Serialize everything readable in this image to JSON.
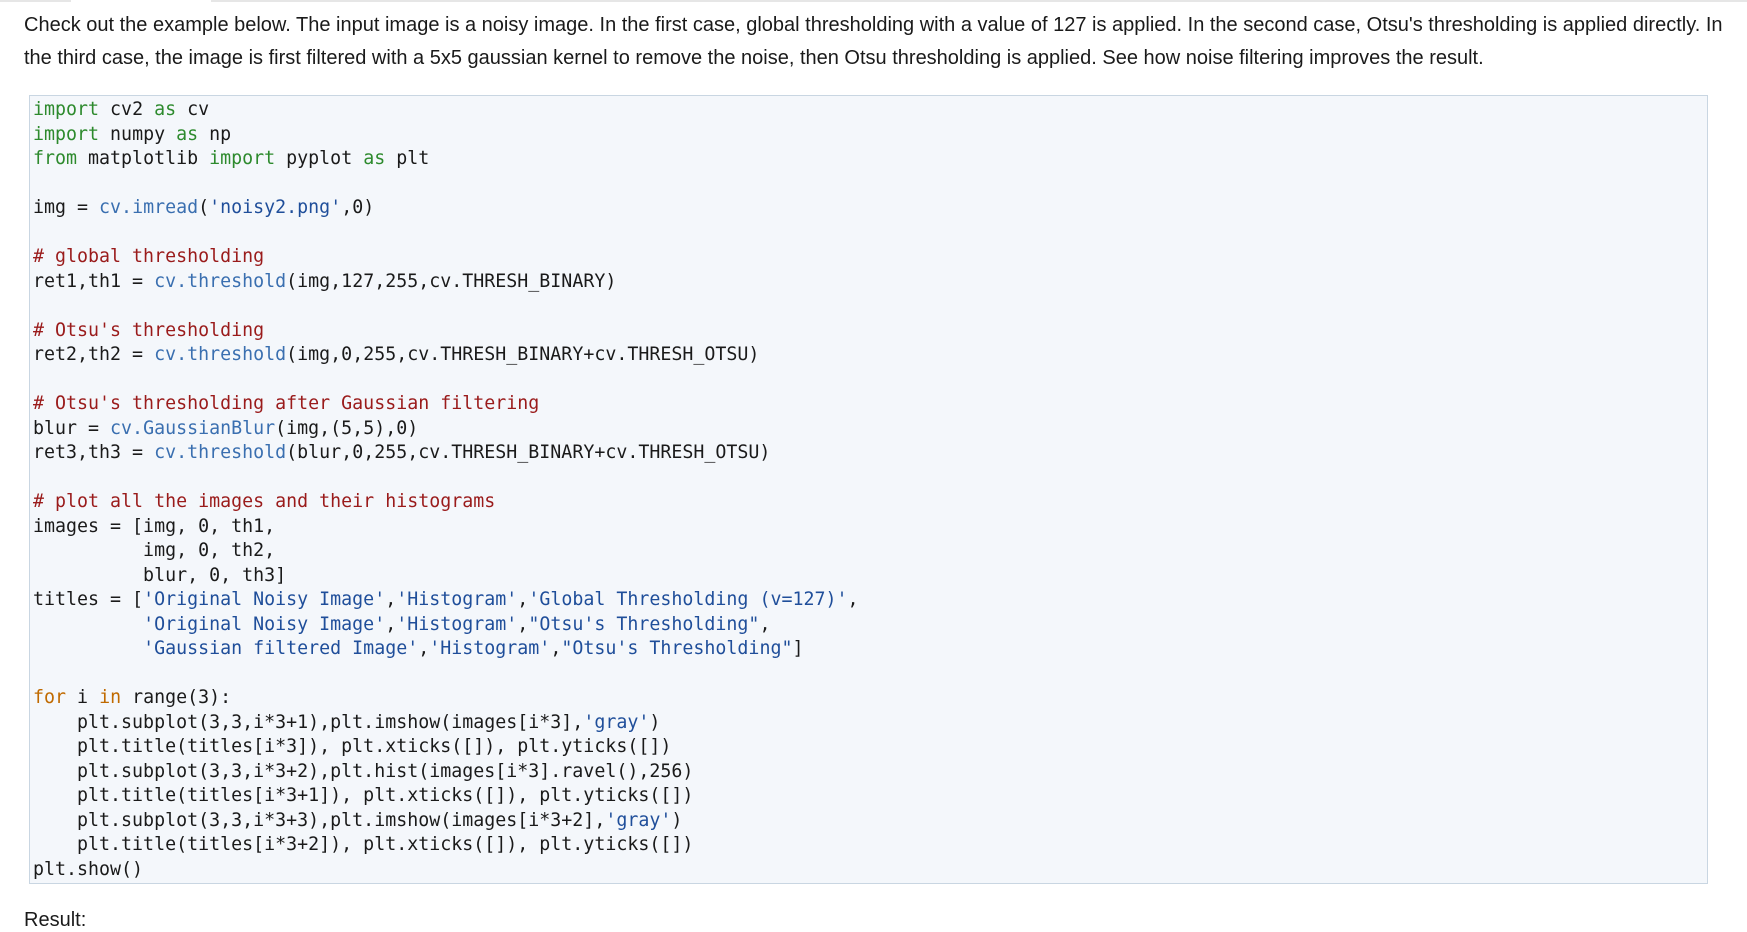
{
  "intro": {
    "text": "Check out the example below. The input image is a noisy image. In the first case, global thresholding with a value of 127 is applied. In the second case, Otsu's thresholding is applied directly. In the third case, the image is first filtered with a 5x5 gaussian kernel to remove the noise, then Otsu thresholding is applied. See how noise filtering improves the result."
  },
  "code": {
    "lines": [
      [
        {
          "t": "import",
          "c": "kw"
        },
        {
          "t": " cv2 "
        },
        {
          "t": "as",
          "c": "kw"
        },
        {
          "t": " cv"
        }
      ],
      [
        {
          "t": "import",
          "c": "kw"
        },
        {
          "t": " numpy "
        },
        {
          "t": "as",
          "c": "kw"
        },
        {
          "t": " np"
        }
      ],
      [
        {
          "t": "from",
          "c": "kw"
        },
        {
          "t": " matplotlib "
        },
        {
          "t": "import",
          "c": "kw"
        },
        {
          "t": " pyplot "
        },
        {
          "t": "as",
          "c": "kw"
        },
        {
          "t": " plt"
        }
      ],
      [],
      [
        {
          "t": "img = "
        },
        {
          "t": "cv.imread",
          "c": "fn"
        },
        {
          "t": "("
        },
        {
          "t": "'noisy2.png'",
          "c": "st"
        },
        {
          "t": ",0)"
        }
      ],
      [],
      [
        {
          "t": "# global thresholding",
          "c": "cm"
        }
      ],
      [
        {
          "t": "ret1,th1 = "
        },
        {
          "t": "cv.threshold",
          "c": "fn"
        },
        {
          "t": "(img,127,255,cv.THRESH_BINARY)"
        }
      ],
      [],
      [
        {
          "t": "# Otsu's thresholding",
          "c": "cm"
        }
      ],
      [
        {
          "t": "ret2,th2 = "
        },
        {
          "t": "cv.threshold",
          "c": "fn"
        },
        {
          "t": "(img,0,255,cv.THRESH_BINARY+cv.THRESH_OTSU)"
        }
      ],
      [],
      [
        {
          "t": "# Otsu's thresholding after Gaussian filtering",
          "c": "cm"
        }
      ],
      [
        {
          "t": "blur = "
        },
        {
          "t": "cv.GaussianBlur",
          "c": "fn"
        },
        {
          "t": "(img,(5,5),0)"
        }
      ],
      [
        {
          "t": "ret3,th3 = "
        },
        {
          "t": "cv.threshold",
          "c": "fn"
        },
        {
          "t": "(blur,0,255,cv.THRESH_BINARY+cv.THRESH_OTSU)"
        }
      ],
      [],
      [
        {
          "t": "# plot all the images and their histograms",
          "c": "cm"
        }
      ],
      [
        {
          "t": "images = [img, 0, th1,"
        }
      ],
      [
        {
          "t": "          img, 0, th2,"
        }
      ],
      [
        {
          "t": "          blur, 0, th3]"
        }
      ],
      [
        {
          "t": "titles = ["
        },
        {
          "t": "'Original Noisy Image'",
          "c": "st"
        },
        {
          "t": ","
        },
        {
          "t": "'Histogram'",
          "c": "st"
        },
        {
          "t": ","
        },
        {
          "t": "'Global Thresholding (v=127)'",
          "c": "st"
        },
        {
          "t": ","
        }
      ],
      [
        {
          "t": "          "
        },
        {
          "t": "'Original Noisy Image'",
          "c": "st"
        },
        {
          "t": ","
        },
        {
          "t": "'Histogram'",
          "c": "st"
        },
        {
          "t": ","
        },
        {
          "t": "\"Otsu's Thresholding\"",
          "c": "st"
        },
        {
          "t": ","
        }
      ],
      [
        {
          "t": "          "
        },
        {
          "t": "'Gaussian filtered Image'",
          "c": "st"
        },
        {
          "t": ","
        },
        {
          "t": "'Histogram'",
          "c": "st"
        },
        {
          "t": ","
        },
        {
          "t": "\"Otsu's Thresholding\"",
          "c": "st"
        },
        {
          "t": "]"
        }
      ],
      [],
      [
        {
          "t": "for",
          "c": "kw2"
        },
        {
          "t": " i "
        },
        {
          "t": "in",
          "c": "kw2"
        },
        {
          "t": " range(3):"
        }
      ],
      [
        {
          "t": "    plt.subplot(3,3,i*3+1),plt.imshow(images[i*3],"
        },
        {
          "t": "'gray'",
          "c": "st"
        },
        {
          "t": ")"
        }
      ],
      [
        {
          "t": "    plt.title(titles[i*3]), plt.xticks([]), plt.yticks([])"
        }
      ],
      [
        {
          "t": "    plt.subplot(3,3,i*3+2),plt.hist(images[i*3].ravel(),256)"
        }
      ],
      [
        {
          "t": "    plt.title(titles[i*3+1]), plt.xticks([]), plt.yticks([])"
        }
      ],
      [
        {
          "t": "    plt.subplot(3,3,i*3+3),plt.imshow(images[i*3+2],"
        },
        {
          "t": "'gray'",
          "c": "st"
        },
        {
          "t": ")"
        }
      ],
      [
        {
          "t": "    plt.title(titles[i*3+2]), plt.xticks([]), plt.yticks([])"
        }
      ],
      [
        {
          "t": "plt.show()"
        }
      ]
    ]
  },
  "result": {
    "label": "Result:"
  },
  "colors": {
    "keyword": "#2d8a2d",
    "comment": "#9a1b1b",
    "string": "#1f4e9a",
    "function": "#3a6fb0",
    "control_keyword": "#c06a00",
    "code_background": "#f4f7fb",
    "code_border": "#c9d6e2"
  }
}
